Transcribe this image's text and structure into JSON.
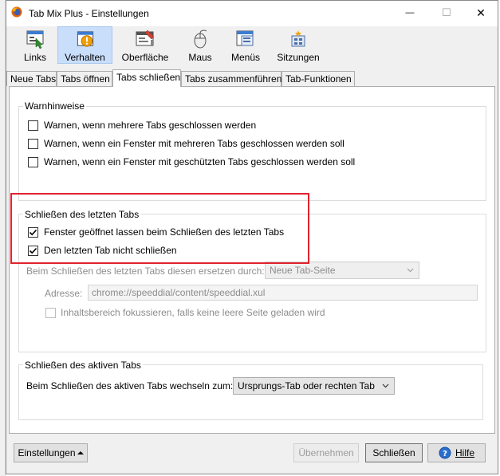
{
  "window": {
    "title": "Tab Mix Plus - Einstellungen",
    "controls": {
      "minimize": "—",
      "maximize": "☐",
      "close": "✕"
    }
  },
  "toolbar": {
    "items": [
      {
        "label": "Links",
        "icon": "links-icon",
        "active": false
      },
      {
        "label": "Verhalten",
        "icon": "behavior-icon",
        "active": true
      },
      {
        "label": "Oberfläche",
        "icon": "appearance-icon",
        "active": false
      },
      {
        "label": "Maus",
        "icon": "mouse-icon",
        "active": false
      },
      {
        "label": "Menüs",
        "icon": "menus-icon",
        "active": false
      },
      {
        "label": "Sitzungen",
        "icon": "sessions-icon",
        "active": false
      }
    ]
  },
  "tabs": [
    {
      "label": "Neue Tabs",
      "selected": false
    },
    {
      "label": "Tabs öffnen",
      "selected": false
    },
    {
      "label": "Tabs schließen",
      "selected": true
    },
    {
      "label": "Tabs zusammenführen",
      "selected": false
    },
    {
      "label": "Tab-Funktionen",
      "selected": false
    }
  ],
  "warnings": {
    "title": "Warnhinweise",
    "items": [
      {
        "label": "Warnen, wenn mehrere Tabs geschlossen werden",
        "checked": false
      },
      {
        "label": "Warnen, wenn ein Fenster mit mehreren Tabs geschlossen werden soll",
        "checked": false
      },
      {
        "label": "Warnen, wenn ein Fenster mit geschützten Tabs geschlossen werden soll",
        "checked": false
      }
    ]
  },
  "last_tab": {
    "title": "Schließen des letzten Tabs",
    "items": [
      {
        "label": "Fenster geöffnet lassen beim Schließen des letzten Tabs",
        "checked": true
      },
      {
        "label": "Den letzten Tab nicht schließen",
        "checked": true
      }
    ],
    "replace_label": "Beim Schließen des letzten Tabs diesen ersetzen durch::",
    "replace_value": "Neue Tab-Seite",
    "address_label": "Adresse:",
    "address_value": "chrome://speeddial/content/speeddial.xul",
    "focus_label": "Inhaltsbereich fokussieren, falls keine leere Seite geladen wird",
    "focus_checked": false
  },
  "active_tab": {
    "title": "Schließen des aktiven Tabs",
    "switch_label": "Beim Schließen des aktiven Tabs wechseln zum:",
    "switch_value": "Ursprungs-Tab oder rechten Tab"
  },
  "footer": {
    "settings_label": "Einstellungen",
    "apply_label": "Übernehmen",
    "close_label": "Schließen",
    "help_label": "Hilfe"
  },
  "colors": {
    "highlight_frame": "#e0232e",
    "active_toolbar_bg": "#c9defa"
  }
}
